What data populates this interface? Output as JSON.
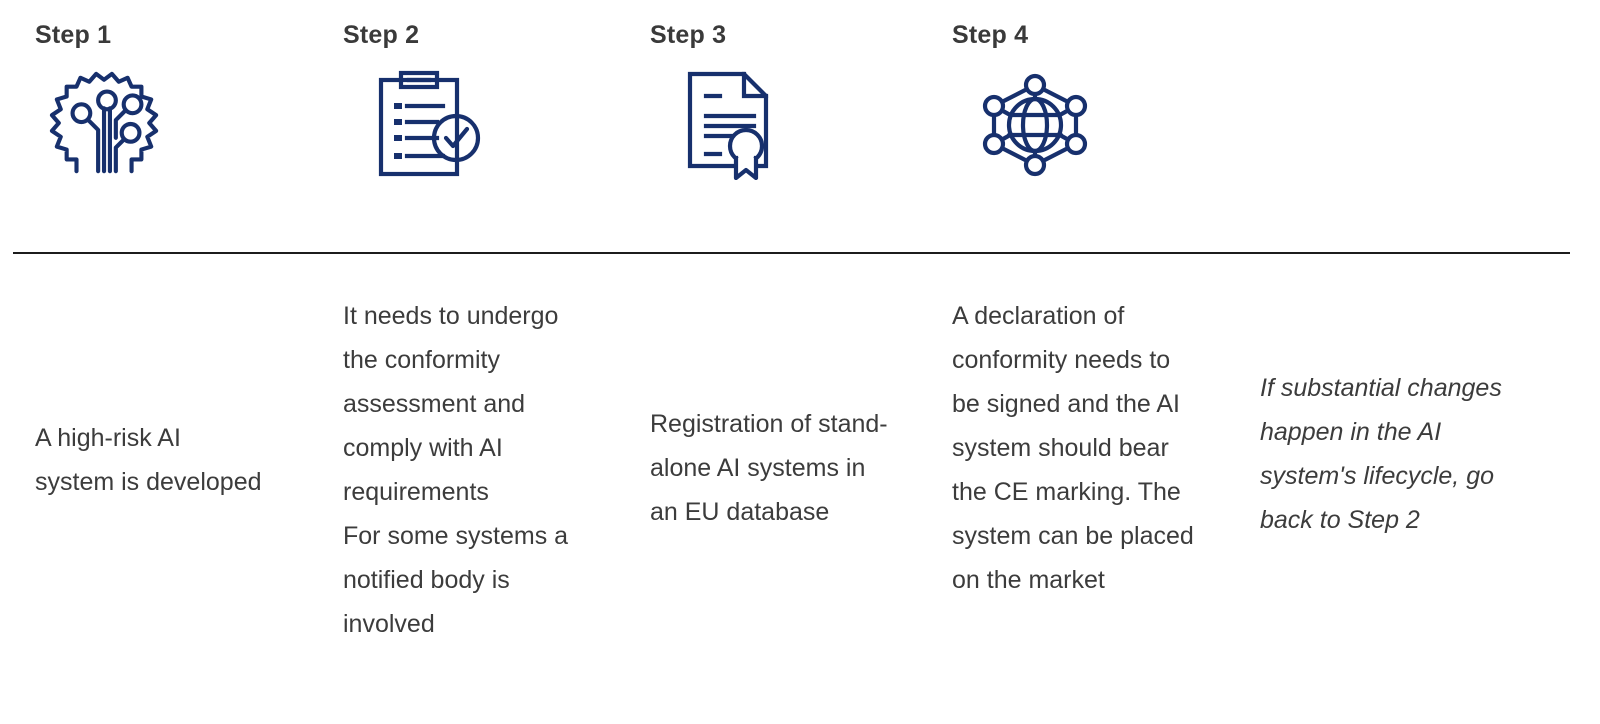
{
  "steps": [
    {
      "label": "Step 1",
      "icon": "ai-circuit-gear-icon"
    },
    {
      "label": "Step 2",
      "icon": "clipboard-check-icon"
    },
    {
      "label": "Step 3",
      "icon": "certificate-seal-icon"
    },
    {
      "label": "Step 4",
      "icon": "globe-network-icon"
    }
  ],
  "descriptions": {
    "col1": {
      "text1": "A high-risk AI system is developed"
    },
    "col2": {
      "text1": "It needs to undergo the conformity assessment and comply with AI requirements",
      "text2": "For some systems a notified body is involved"
    },
    "col3": {
      "text1": "Registration of stand-alone AI systems in an EU database"
    },
    "col4": {
      "text1": "A declaration of conformity needs to be signed and the AI system should bear the CE marking. The system can be placed on the market"
    },
    "col5": {
      "text1": "If substantial changes happen in the AI system's lifecycle, go back to Step 2"
    }
  },
  "colors": {
    "icon_navy": "#17306d",
    "heading_gray": "#3a3a3a",
    "body_gray": "#3c3c3c",
    "divider": "#1c1c1c",
    "background": "#ffffff"
  }
}
